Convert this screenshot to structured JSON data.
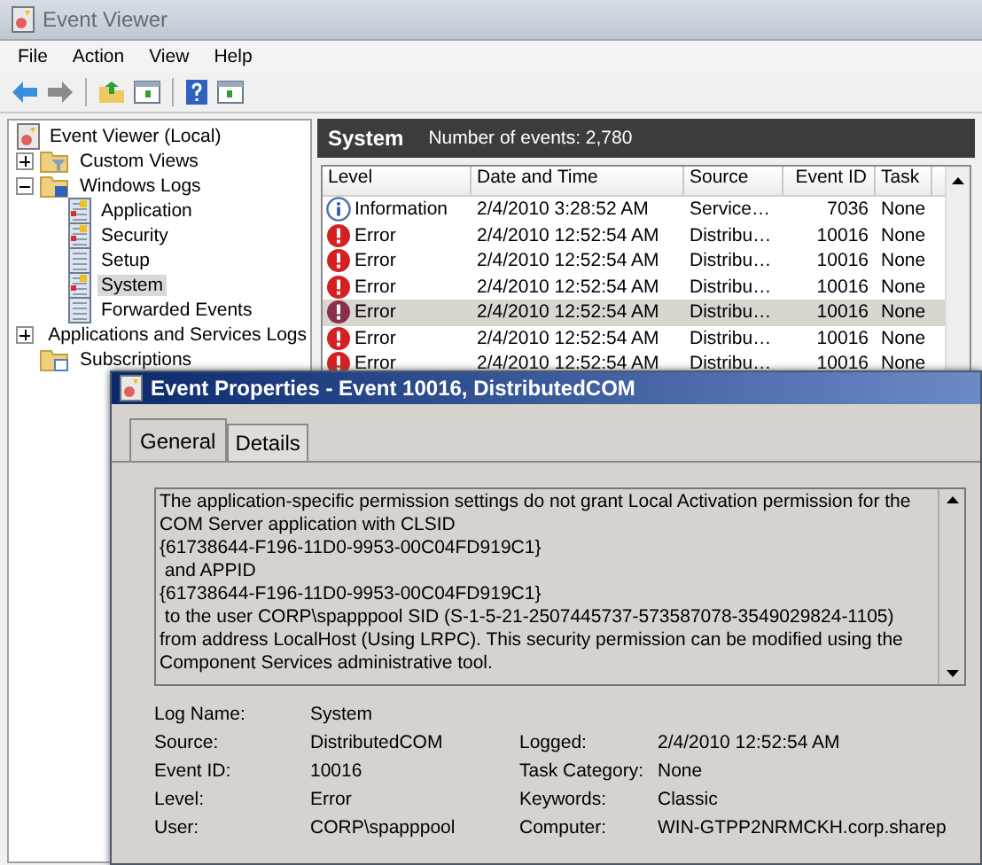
{
  "window": {
    "title": "Event Viewer"
  },
  "menu": [
    "File",
    "Action",
    "View",
    "Help"
  ],
  "tree": [
    {
      "label": "Event Viewer (Local)",
      "kind": "root",
      "selected": false,
      "children": [
        {
          "label": "Custom Views",
          "kind": "filter-folder",
          "expanded": false,
          "selected": false
        },
        {
          "label": "Windows Logs",
          "kind": "logs-folder",
          "expanded": true,
          "selected": false,
          "children": [
            {
              "label": "Application",
              "kind": "log",
              "selected": false
            },
            {
              "label": "Security",
              "kind": "log",
              "selected": false
            },
            {
              "label": "Setup",
              "kind": "plain-log",
              "selected": false
            },
            {
              "label": "System",
              "kind": "log",
              "selected": true
            },
            {
              "label": "Forwarded Events",
              "kind": "plain-log",
              "selected": false
            }
          ]
        },
        {
          "label": "Applications and Services Logs",
          "kind": "folder",
          "expanded": false,
          "selected": false
        },
        {
          "label": "Subscriptions",
          "kind": "subscriptions",
          "selected": false
        }
      ]
    }
  ],
  "log_panel": {
    "title": "System",
    "count": "Number of events: 2,780",
    "columns": [
      "Level",
      "Date and Time",
      "Source",
      "Event ID",
      "Task"
    ],
    "rows": [
      {
        "kind": "information",
        "level": "Information",
        "date": "2/4/2010 3:28:52 AM",
        "source": "Service…",
        "event_id": "7036",
        "task": "None",
        "selected": false
      },
      {
        "kind": "error",
        "level": "Error",
        "date": "2/4/2010 12:52:54 AM",
        "source": "Distribu…",
        "event_id": "10016",
        "task": "None",
        "selected": false
      },
      {
        "kind": "error",
        "level": "Error",
        "date": "2/4/2010 12:52:54 AM",
        "source": "Distribu…",
        "event_id": "10016",
        "task": "None",
        "selected": false
      },
      {
        "kind": "error",
        "level": "Error",
        "date": "2/4/2010 12:52:54 AM",
        "source": "Distribu…",
        "event_id": "10016",
        "task": "None",
        "selected": false
      },
      {
        "kind": "error",
        "level": "Error",
        "date": "2/4/2010 12:52:54 AM",
        "source": "Distribu…",
        "event_id": "10016",
        "task": "None",
        "selected": true
      },
      {
        "kind": "error",
        "level": "Error",
        "date": "2/4/2010 12:52:54 AM",
        "source": "Distribu…",
        "event_id": "10016",
        "task": "None",
        "selected": false
      },
      {
        "kind": "error",
        "level": "Error",
        "date": "2/4/2010 12:52:54 AM",
        "source": "Distribu…",
        "event_id": "10016",
        "task": "None",
        "selected": false
      }
    ]
  },
  "dialog": {
    "title": "Event Properties - Event 10016, DistributedCOM",
    "tabs": [
      {
        "label": "General",
        "selected": true
      },
      {
        "label": "Details",
        "selected": false
      }
    ],
    "description": "The application-specific permission settings do not grant Local Activation permission for the COM Server application with CLSID \n{61738644-F196-11D0-9953-00C04FD919C1}\n and APPID \n{61738644-F196-11D0-9953-00C04FD919C1}\n to the user CORP\\spapppool SID (S-1-5-21-2507445737-573587078-3549029824-1105) from address LocalHost (Using LRPC). This security permission can be modified using the Component Services administrative tool.",
    "details": [
      {
        "left": {
          "label": "Log Name:",
          "value": "System"
        }
      },
      {
        "left": {
          "label": "Source:",
          "value": "DistributedCOM"
        },
        "right": {
          "label": "Logged:",
          "value": "2/4/2010 12:52:54 AM"
        }
      },
      {
        "left": {
          "label": "Event ID:",
          "value": "10016"
        },
        "right": {
          "label": "Task Category:",
          "value": "None"
        }
      },
      {
        "left": {
          "label": "Level:",
          "value": "Error"
        },
        "right": {
          "label": "Keywords:",
          "value": "Classic"
        }
      },
      {
        "left": {
          "label": "User:",
          "value": "CORP\\spapppool"
        },
        "right": {
          "label": "Computer:",
          "value": "WIN-GTPP2NRMCKH.corp.sharep"
        }
      }
    ]
  }
}
